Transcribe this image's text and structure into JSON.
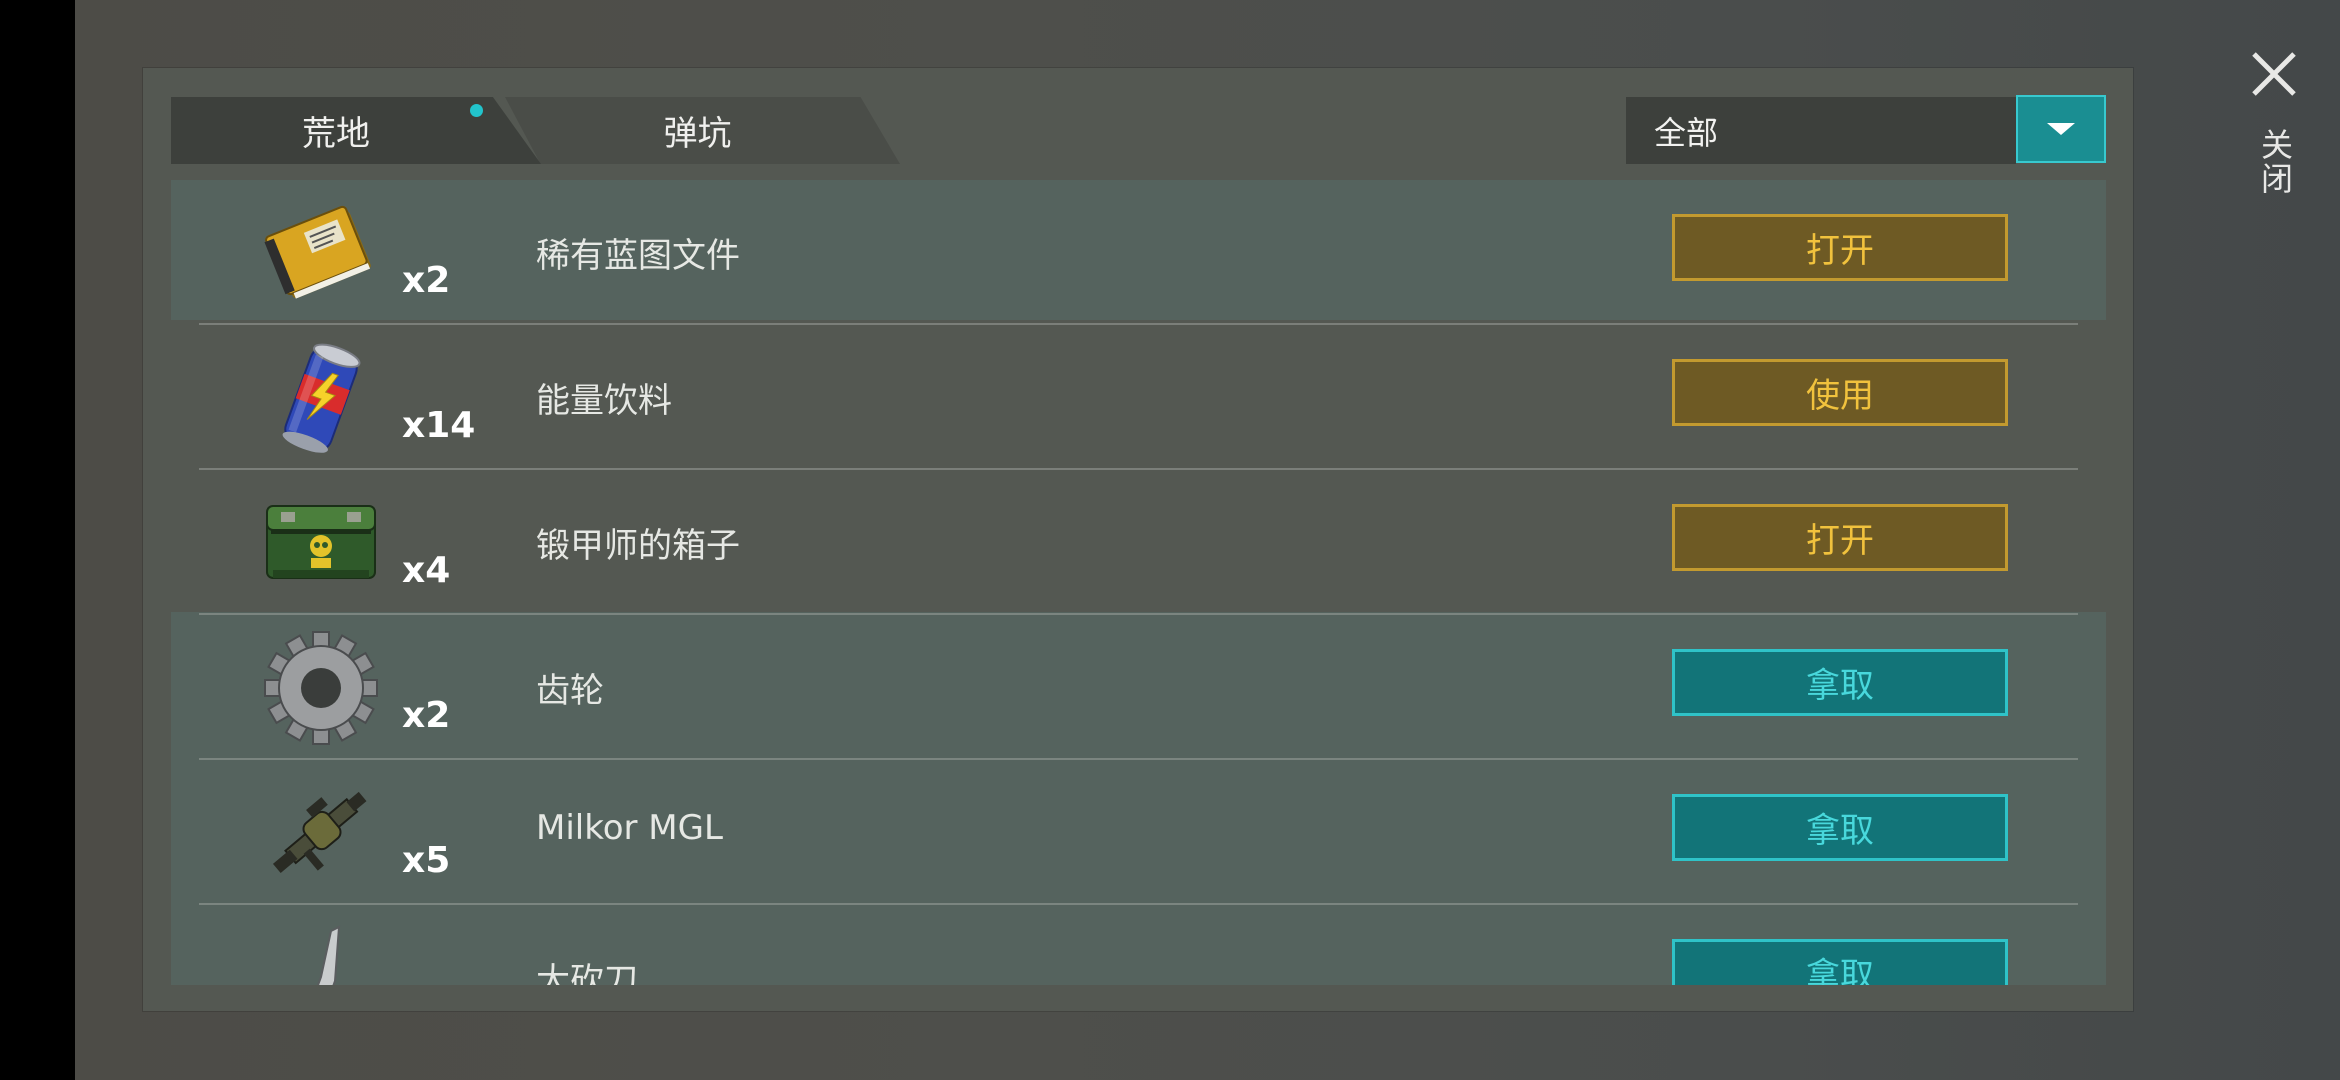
{
  "tabs": [
    {
      "label": "荒地",
      "active": true,
      "has_notification": true
    },
    {
      "label": "弹坑",
      "active": false
    }
  ],
  "filter": {
    "selected": "全部"
  },
  "close": {
    "label": "关闭"
  },
  "items": [
    {
      "icon": "blueprint-folder-icon",
      "quantity": "x2",
      "name": "稀有蓝图文件",
      "action": "打开",
      "style": "gold"
    },
    {
      "icon": "energy-drink-can-icon",
      "quantity": "x14",
      "name": "能量饮料",
      "action": "使用",
      "style": "gold"
    },
    {
      "icon": "armorer-crate-icon",
      "quantity": "x4",
      "name": "锻甲师的箱子",
      "action": "打开",
      "style": "gold"
    },
    {
      "icon": "gear-icon",
      "quantity": "x2",
      "name": "齿轮",
      "action": "拿取",
      "style": "teal"
    },
    {
      "icon": "grenade-launcher-icon",
      "quantity": "x5",
      "name": "Milkor MGL",
      "action": "拿取",
      "style": "teal"
    },
    {
      "icon": "machete-icon",
      "quantity": "",
      "name": "大砍刀",
      "action": "拿取",
      "style": "teal"
    }
  ],
  "colors": {
    "gold_button": "#6e5a24",
    "gold_text": "#f1c23d",
    "teal_button": "#127478",
    "teal_text": "#48d8dc",
    "accent": "#22c4cc"
  }
}
